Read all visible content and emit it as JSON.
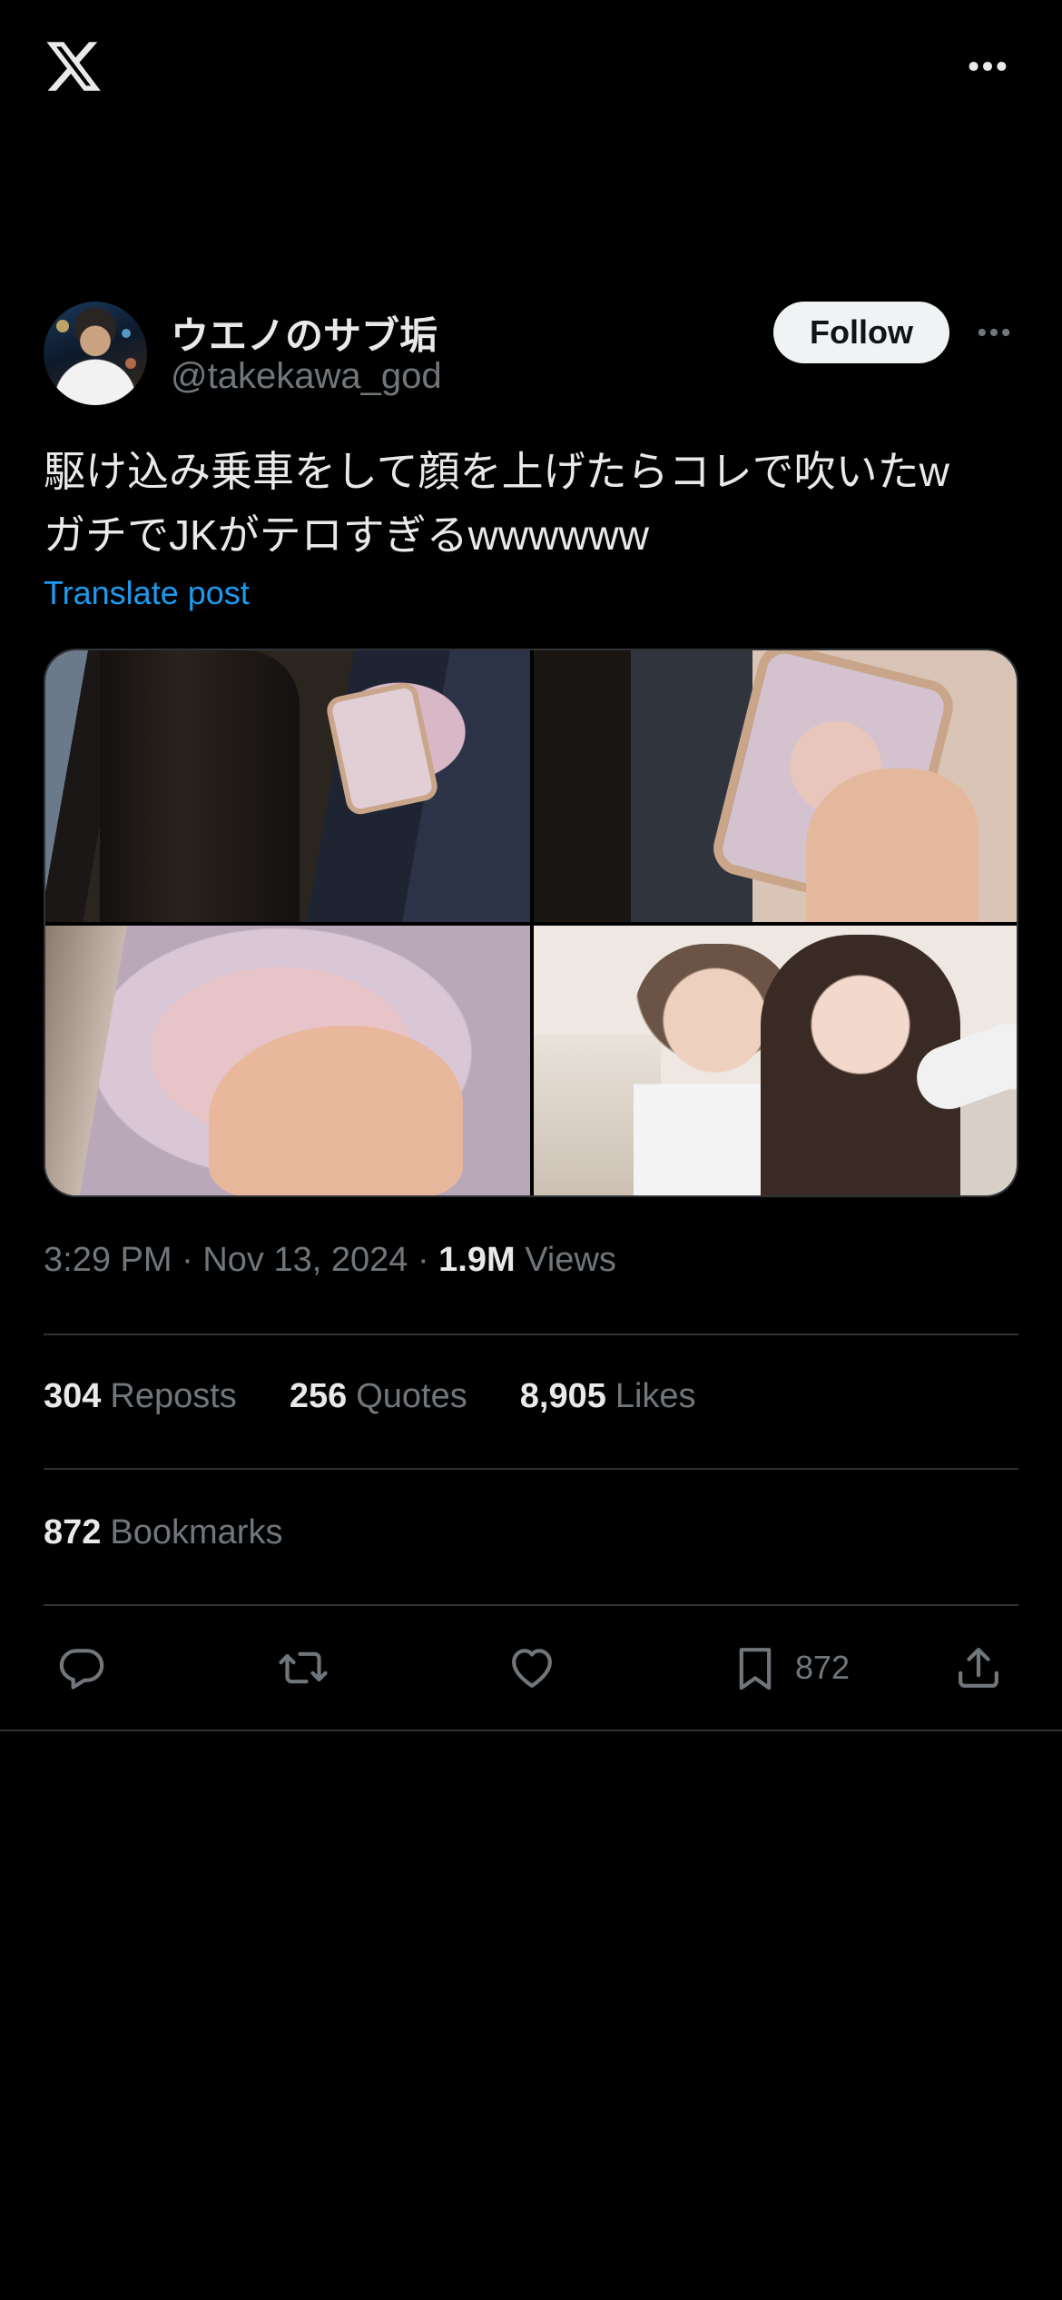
{
  "app": {
    "logo_icon": "x-logo-icon",
    "more_icon": "more-horizontal-icon"
  },
  "author": {
    "display_name": "ウエノのサブ垢",
    "handle": "@takekawa_god",
    "follow_label": "Follow",
    "more_icon": "more-horizontal-icon"
  },
  "post": {
    "lines": [
      "駆け込み乗車をして顔を上げたらコレで吹いたw",
      "ガチでJKがテロすぎるwwwwww"
    ],
    "translate_label": "Translate post",
    "media_count": 4
  },
  "meta": {
    "time": "3:29 PM",
    "date": "Nov 13, 2024",
    "views_count": "1.9M",
    "views_label": "Views"
  },
  "stats": {
    "reposts_count": "304",
    "reposts_label": "Reposts",
    "quotes_count": "256",
    "quotes_label": "Quotes",
    "likes_count": "8,905",
    "likes_label": "Likes",
    "bookmarks_count": "872",
    "bookmarks_label": "Bookmarks"
  },
  "actions": {
    "reply_icon": "reply-icon",
    "repost_icon": "repost-icon",
    "like_icon": "heart-icon",
    "bookmark_icon": "bookmark-icon",
    "bookmark_count": "872",
    "share_icon": "share-icon"
  },
  "colors": {
    "background": "#000000",
    "text_primary": "#e7e9ea",
    "text_secondary": "#71767b",
    "link": "#1d9bf0",
    "divider": "#2f3336",
    "follow_bg": "#eff3f4"
  }
}
